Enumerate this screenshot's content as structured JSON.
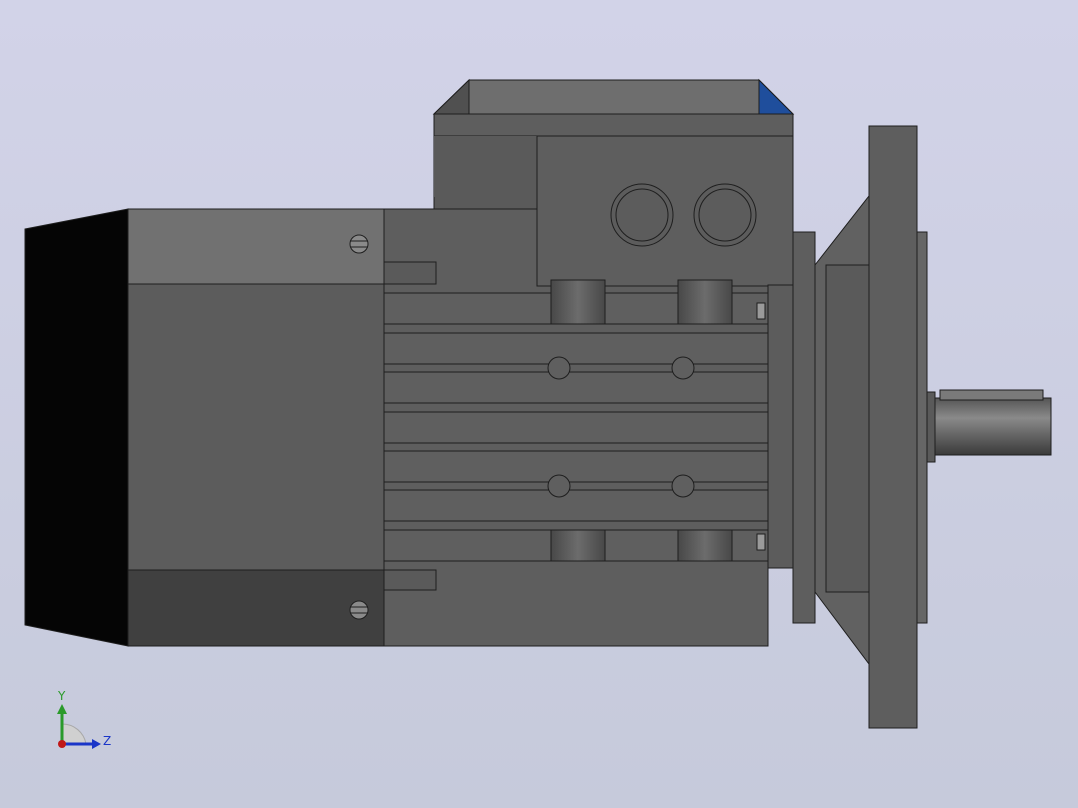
{
  "viewport": {
    "background_top": "#d2d3e8",
    "background_bottom": "#c6cadb"
  },
  "model": {
    "body_dark": "#5a5a5a",
    "body_mid": "#666666",
    "body_light": "#747474",
    "fan_cover": "#050505",
    "edge": "#1e1e1e",
    "accent_face": "#1f4e9c"
  },
  "triad": {
    "y_label": "Y",
    "z_label": "Z",
    "y_color": "#2a9a2a",
    "z_color": "#1a35c8",
    "x_color": "#c01818"
  }
}
